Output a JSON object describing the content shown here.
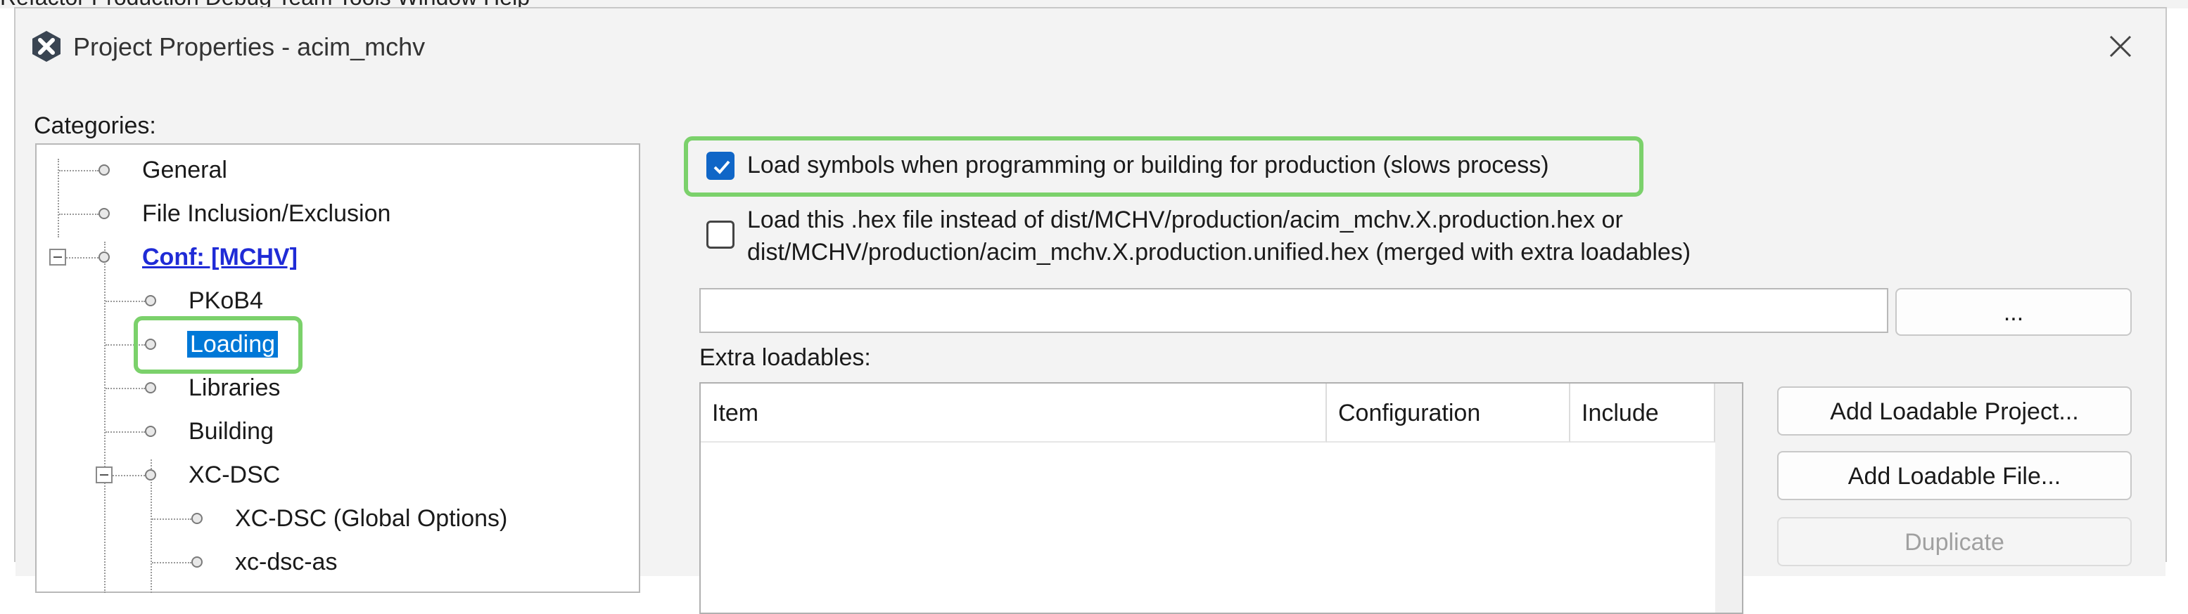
{
  "window": {
    "title": "Project Properties - acim_mchv",
    "menu_remnant": "Refactor  Production  Debug  Team  Tools  Window  Help"
  },
  "categories": {
    "label": "Categories:",
    "items": [
      {
        "label": "General"
      },
      {
        "label": "File Inclusion/Exclusion"
      },
      {
        "label": "Conf: [MCHV]"
      },
      {
        "label": "PKoB4"
      },
      {
        "label": "Loading"
      },
      {
        "label": "Libraries"
      },
      {
        "label": "Building"
      },
      {
        "label": "XC-DSC"
      },
      {
        "label": "XC-DSC (Global Options)"
      },
      {
        "label": "xc-dsc-as"
      }
    ]
  },
  "loading": {
    "load_symbols_label": "Load symbols when programming or building for production (slows process)",
    "load_symbols_checked": true,
    "load_hex_label_line1": "Load this .hex file instead of dist/MCHV/production/acim_mchv.X.production.hex or",
    "load_hex_label_line2": "dist/MCHV/production/acim_mchv.X.production.unified.hex (merged with extra loadables)",
    "load_hex_checked": false,
    "hex_path_value": "",
    "browse_label": "...",
    "extra_loadables_label": "Extra loadables:",
    "table_columns": [
      "Item",
      "Configuration",
      "Include"
    ],
    "buttons": {
      "add_project": "Add Loadable Project...",
      "add_file": "Add Loadable File...",
      "duplicate": "Duplicate"
    }
  },
  "colors": {
    "accent": "#0078d7",
    "highlight": "#7bd16b",
    "conf_link": "#1f2bd6"
  }
}
